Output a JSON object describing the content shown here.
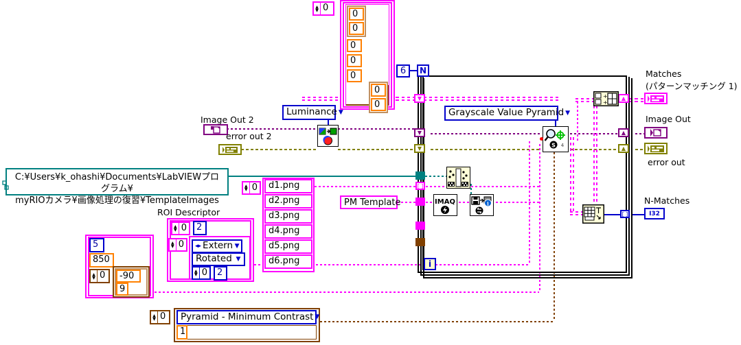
{
  "app": {
    "title": "LabVIEW Block Diagram - Pattern Matching",
    "kind": "labview-block-diagram"
  },
  "labels": {
    "image_out_2": "Image Out 2",
    "error_out_2": "error out 2",
    "roi_descriptor": "ROI Descriptor",
    "matches": "Matches",
    "matches_sub": "(パターンマッチング 1)",
    "image_out": "Image Out",
    "error_out": "error out",
    "n_matches": "N-Matches"
  },
  "path_constant": {
    "line1": "C:¥Users¥k_ohashi¥Documents¥LabVIEWプログラム¥",
    "line2": "myRIOカメラ¥画像処理の復習¥TemplateImages"
  },
  "rings": {
    "luminance": "Luminance",
    "grayscale_value_pyramid": "Grayscale Value Pyramid",
    "extern": "Extern",
    "rotated": "Rotated",
    "pyramid_min_contrast": "Pyramid - Minimum Contrast"
  },
  "string_constants": {
    "pm_template": "PM Template",
    "file_list": [
      "d1.png",
      "d2.png",
      "d3.png",
      "d4.png",
      "d5.png",
      "d6.png"
    ]
  },
  "constants": {
    "loop_count": "6",
    "n_terminal": "N",
    "i_terminal": "i",
    "index_zero": "0",
    "match_mode_index": "0",
    "pm_contrast_index": "0",
    "pm_contrast_value": "1",
    "roi_index_a": "0",
    "roi_index_b": "0",
    "roi_two_a": "2",
    "roi_rot_index": "0",
    "roi_two_b": "2",
    "score_min": "5",
    "max_match": "850",
    "angle_index": "0",
    "angle_low": "-90",
    "angle_high": "9",
    "array_zeros": [
      "0",
      "0",
      "0",
      "0",
      "0",
      "0",
      "0",
      "0"
    ],
    "file_index": "0",
    "i32_type": "I32",
    "match_node_badge": "4"
  },
  "icons": {
    "cast_image_type": "color-to-luminance-icon",
    "imaq_create": "imaq-create-icon",
    "imaq_read_file": "imaq-read-image-file-icon",
    "build_path": "build-path-icon",
    "match_pattern": "imaq-match-pattern-icon",
    "index_array": "index-array-icon",
    "array_size": "array-size-icon",
    "path_icon": "path-constant-icon",
    "dropdown_arrow": "chevron-down-icon",
    "spinner": "increment-decrement-icon"
  },
  "colors": {
    "wire_image": "#800080",
    "wire_error": "#808000",
    "wire_cluster": "#ff00ff",
    "wire_path": "#008080",
    "wire_double": "#ff8000",
    "wire_number": "#804000",
    "wire_i32": "#0000cc",
    "structure": "#000000"
  }
}
